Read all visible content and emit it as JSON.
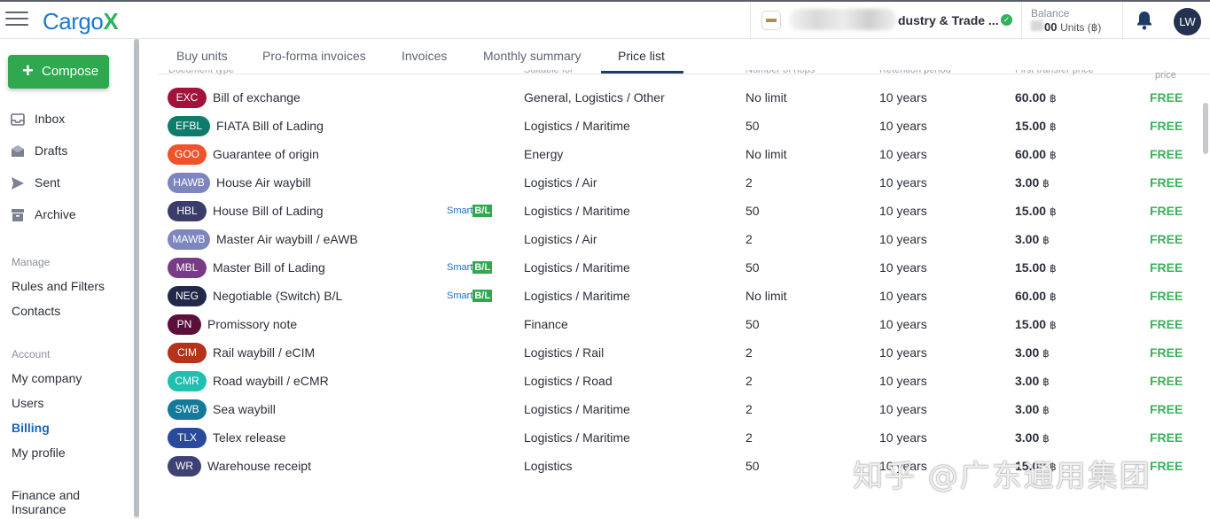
{
  "app": {
    "logo_text": "Cargo",
    "logo_x": "X",
    "company_name": "dustry & Trade ...",
    "balance_label": "Balance",
    "balance_value": "00",
    "balance_units": "Units (฿)",
    "avatar_initials": "LW"
  },
  "sidebar": {
    "compose_label": "Compose",
    "mail": [
      {
        "label": "Inbox",
        "icon": "inbox-icon"
      },
      {
        "label": "Drafts",
        "icon": "drafts-icon"
      },
      {
        "label": "Sent",
        "icon": "sent-icon"
      },
      {
        "label": "Archive",
        "icon": "archive-icon"
      }
    ],
    "manage_title": "Manage",
    "manage": [
      "Rules and Filters",
      "Contacts"
    ],
    "account_title": "Account",
    "account": [
      "My company",
      "Users",
      "Billing",
      "My profile"
    ],
    "finance_line1": "Finance and",
    "finance_line2": "Insurance"
  },
  "tabs": [
    "Buy units",
    "Pro-forma invoices",
    "Invoices",
    "Monthly summary",
    "Price list"
  ],
  "active_tab": "Price list",
  "table_header": {
    "doc_type": "Document type",
    "suitable": "Suitable for",
    "hops": "Number of hops",
    "retention": "Retention period",
    "first_transfer": "First transfer price",
    "price": "price"
  },
  "smart_bl": {
    "prefix": "Smart",
    "suffix": "B/L"
  },
  "rows": [
    {
      "code": "EXC",
      "name": "Bill of exchange",
      "smart": false,
      "category": "General, Logistics / Other",
      "hops": "No limit",
      "retention": "10 years",
      "price": "60.00",
      "currency": "฿",
      "after": "FREE",
      "color": "#a3123a"
    },
    {
      "code": "EFBL",
      "name": "FIATA Bill of Lading",
      "smart": false,
      "category": "Logistics / Maritime",
      "hops": "50",
      "retention": "10 years",
      "price": "15.00",
      "currency": "฿",
      "after": "FREE",
      "color": "#0e7c6b"
    },
    {
      "code": "GOO",
      "name": "Guarantee of origin",
      "smart": false,
      "category": "Energy",
      "hops": "No limit",
      "retention": "10 years",
      "price": "60.00",
      "currency": "฿",
      "after": "FREE",
      "color": "#f0522a"
    },
    {
      "code": "HAWB",
      "name": "House Air waybill",
      "smart": false,
      "category": "Logistics / Air",
      "hops": "2",
      "retention": "10 years",
      "price": "3.00",
      "currency": "฿",
      "after": "FREE",
      "color": "#7d86bd"
    },
    {
      "code": "HBL",
      "name": "House Bill of Lading",
      "smart": true,
      "category": "Logistics / Maritime",
      "hops": "50",
      "retention": "10 years",
      "price": "15.00",
      "currency": "฿",
      "after": "FREE",
      "color": "#3a3d6a"
    },
    {
      "code": "MAWB",
      "name": "Master Air waybill / eAWB",
      "smart": false,
      "category": "Logistics / Air",
      "hops": "2",
      "retention": "10 years",
      "price": "3.00",
      "currency": "฿",
      "after": "FREE",
      "color": "#7d86bd"
    },
    {
      "code": "MBL",
      "name": "Master Bill of Lading",
      "smart": true,
      "category": "Logistics / Maritime",
      "hops": "50",
      "retention": "10 years",
      "price": "15.00",
      "currency": "฿",
      "after": "FREE",
      "color": "#7a3b86"
    },
    {
      "code": "NEG",
      "name": "Negotiable (Switch) B/L",
      "smart": true,
      "category": "Logistics / Maritime",
      "hops": "No limit",
      "retention": "10 years",
      "price": "60.00",
      "currency": "฿",
      "after": "FREE",
      "color": "#23284a"
    },
    {
      "code": "PN",
      "name": "Promissory note",
      "smart": false,
      "category": "Finance",
      "hops": "50",
      "retention": "10 years",
      "price": "15.00",
      "currency": "฿",
      "after": "FREE",
      "color": "#5b0f3a"
    },
    {
      "code": "CIM",
      "name": "Rail waybill / eCIM",
      "smart": false,
      "category": "Logistics / Rail",
      "hops": "2",
      "retention": "10 years",
      "price": "3.00",
      "currency": "฿",
      "after": "FREE",
      "color": "#b3341a"
    },
    {
      "code": "CMR",
      "name": "Road waybill / eCMR",
      "smart": false,
      "category": "Logistics / Road",
      "hops": "2",
      "retention": "10 years",
      "price": "3.00",
      "currency": "฿",
      "after": "FREE",
      "color": "#21bfb0"
    },
    {
      "code": "SWB",
      "name": "Sea waybill",
      "smart": false,
      "category": "Logistics / Maritime",
      "hops": "2",
      "retention": "10 years",
      "price": "3.00",
      "currency": "฿",
      "after": "FREE",
      "color": "#137a99"
    },
    {
      "code": "TLX",
      "name": "Telex release",
      "smart": false,
      "category": "Logistics / Maritime",
      "hops": "2",
      "retention": "10 years",
      "price": "3.00",
      "currency": "฿",
      "after": "FREE",
      "color": "#2a4a9c"
    },
    {
      "code": "WR",
      "name": "Warehouse receipt",
      "smart": false,
      "category": "Logistics",
      "hops": "50",
      "retention": "10 years",
      "price": "15.00",
      "currency": "฿",
      "after": "FREE",
      "color": "#3e4273"
    }
  ],
  "watermark": "知乎 @广东通用集团"
}
